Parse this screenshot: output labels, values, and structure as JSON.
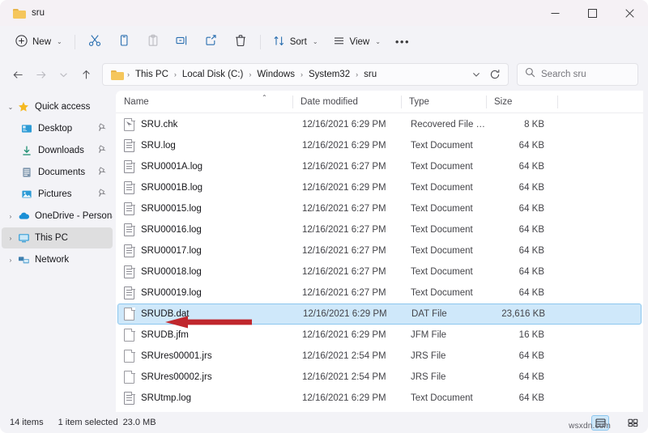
{
  "window": {
    "tab_title": "sru",
    "folder_icon": "folder-icon",
    "minimize": "–",
    "maximize": "□",
    "close": "✕"
  },
  "toolbar": {
    "new_label": "New",
    "new_icon": "plus-circle-icon",
    "cut_icon": "scissors-icon",
    "copy_icon": "copy-icon",
    "paste_icon": "paste-icon",
    "rename_icon": "rename-icon",
    "share_icon": "share-icon",
    "delete_icon": "trash-icon",
    "sort_label": "Sort",
    "sort_icon": "sort-arrows-icon",
    "view_label": "View",
    "view_icon": "view-lines-icon",
    "more_label": "•••",
    "chevron": "⌄"
  },
  "address": {
    "back_icon": "arrow-left-icon",
    "forward_icon": "arrow-right-icon",
    "recent_icon": "chevron-down-icon",
    "up_icon": "arrow-up-icon",
    "folder_icon": "folder-icon",
    "breadcrumbs": [
      "This PC",
      "Local Disk (C:)",
      "Windows",
      "System32",
      "sru"
    ],
    "separator": "›",
    "dropdown_icon": "chevron-down-icon",
    "refresh_icon": "refresh-icon",
    "search_icon": "search-icon",
    "search_placeholder": "Search sru"
  },
  "sidebar": {
    "items": [
      {
        "label": "Quick access",
        "icon": "star-icon",
        "twisty": "⌄",
        "indent": false,
        "pinned": false,
        "selected": false
      },
      {
        "label": "Desktop",
        "icon": "desktop-icon",
        "twisty": "",
        "indent": true,
        "pinned": true,
        "selected": false
      },
      {
        "label": "Downloads",
        "icon": "download-icon",
        "twisty": "",
        "indent": true,
        "pinned": true,
        "selected": false
      },
      {
        "label": "Documents",
        "icon": "documents-icon",
        "twisty": "",
        "indent": true,
        "pinned": true,
        "selected": false
      },
      {
        "label": "Pictures",
        "icon": "pictures-icon",
        "twisty": "",
        "indent": true,
        "pinned": true,
        "selected": false
      },
      {
        "label": "OneDrive - Personal",
        "icon": "cloud-icon",
        "twisty": "›",
        "indent": false,
        "pinned": false,
        "selected": false
      },
      {
        "label": "This PC",
        "icon": "monitor-icon",
        "twisty": "›",
        "indent": false,
        "pinned": false,
        "selected": true
      },
      {
        "label": "Network",
        "icon": "network-icon",
        "twisty": "›",
        "indent": false,
        "pinned": false,
        "selected": false
      }
    ],
    "pin_glyph": "📌"
  },
  "filelist": {
    "columns": [
      "Name",
      "Date modified",
      "Type",
      "Size"
    ],
    "sort_caret": "⌃",
    "rows": [
      {
        "name": "SRU.chk",
        "date": "12/16/2021 6:29 PM",
        "type": "Recovered File Fra...",
        "size": "8 KB",
        "icon": "chk-file-icon",
        "selected": false
      },
      {
        "name": "SRU.log",
        "date": "12/16/2021 6:29 PM",
        "type": "Text Document",
        "size": "64 KB",
        "icon": "text-file-icon",
        "selected": false
      },
      {
        "name": "SRU0001A.log",
        "date": "12/16/2021 6:27 PM",
        "type": "Text Document",
        "size": "64 KB",
        "icon": "text-file-icon",
        "selected": false
      },
      {
        "name": "SRU0001B.log",
        "date": "12/16/2021 6:29 PM",
        "type": "Text Document",
        "size": "64 KB",
        "icon": "text-file-icon",
        "selected": false
      },
      {
        "name": "SRU00015.log",
        "date": "12/16/2021 6:27 PM",
        "type": "Text Document",
        "size": "64 KB",
        "icon": "text-file-icon",
        "selected": false
      },
      {
        "name": "SRU00016.log",
        "date": "12/16/2021 6:27 PM",
        "type": "Text Document",
        "size": "64 KB",
        "icon": "text-file-icon",
        "selected": false
      },
      {
        "name": "SRU00017.log",
        "date": "12/16/2021 6:27 PM",
        "type": "Text Document",
        "size": "64 KB",
        "icon": "text-file-icon",
        "selected": false
      },
      {
        "name": "SRU00018.log",
        "date": "12/16/2021 6:27 PM",
        "type": "Text Document",
        "size": "64 KB",
        "icon": "text-file-icon",
        "selected": false
      },
      {
        "name": "SRU00019.log",
        "date": "12/16/2021 6:27 PM",
        "type": "Text Document",
        "size": "64 KB",
        "icon": "text-file-icon",
        "selected": false
      },
      {
        "name": "SRUDB.dat",
        "date": "12/16/2021 6:29 PM",
        "type": "DAT File",
        "size": "23,616 KB",
        "icon": "blank-file-icon",
        "selected": true
      },
      {
        "name": "SRUDB.jfm",
        "date": "12/16/2021 6:29 PM",
        "type": "JFM File",
        "size": "16 KB",
        "icon": "blank-file-icon",
        "selected": false
      },
      {
        "name": "SRUres00001.jrs",
        "date": "12/16/2021 2:54 PM",
        "type": "JRS File",
        "size": "64 KB",
        "icon": "blank-file-icon",
        "selected": false
      },
      {
        "name": "SRUres00002.jrs",
        "date": "12/16/2021 2:54 PM",
        "type": "JRS File",
        "size": "64 KB",
        "icon": "blank-file-icon",
        "selected": false
      },
      {
        "name": "SRUtmp.log",
        "date": "12/16/2021 6:29 PM",
        "type": "Text Document",
        "size": "64 KB",
        "icon": "text-file-icon",
        "selected": false
      }
    ]
  },
  "annotation": {
    "arrow_color": "#c0272d",
    "target": "SRUDB.dat"
  },
  "statusbar": {
    "item_count": "14 items",
    "selection": "1 item selected",
    "selection_size": "23.0 MB",
    "details_view_icon": "details-view-icon",
    "large_icons_view_icon": "large-icons-view-icon",
    "watermark": "wsxdn.com"
  }
}
